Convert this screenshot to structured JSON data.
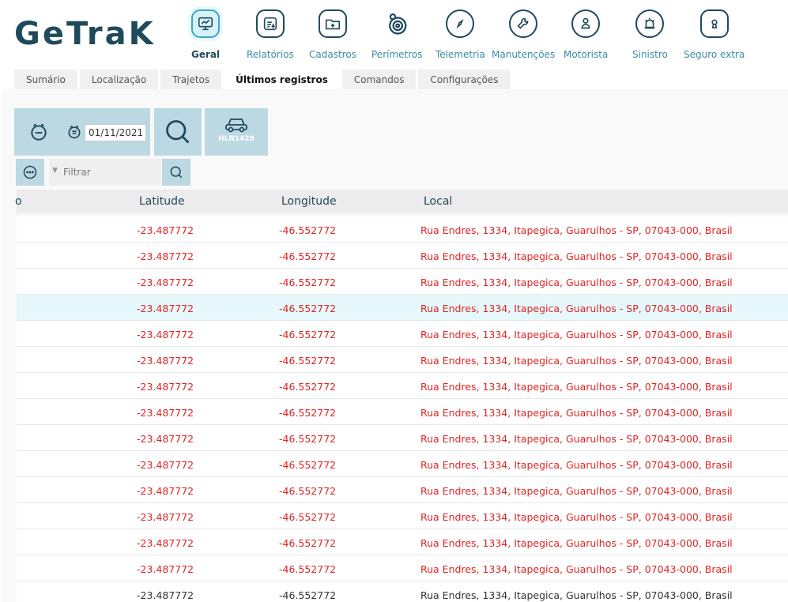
{
  "brand": {
    "logo_text": "GeTraK"
  },
  "nav": [
    {
      "label": "Geral",
      "icon": "monitor-icon",
      "active": true
    },
    {
      "label": "Relatórios",
      "icon": "report-icon",
      "active": false
    },
    {
      "label": "Cadastros",
      "icon": "folder-plus-icon",
      "active": false
    },
    {
      "label": "Perímetros",
      "icon": "perimeter-icon",
      "active": false
    },
    {
      "label": "Telemetria",
      "icon": "compass-icon",
      "active": false
    },
    {
      "label": "Manutenções",
      "icon": "wrench-icon",
      "active": false
    },
    {
      "label": "Motorista",
      "icon": "driver-icon",
      "active": false
    },
    {
      "label": "Sinistro",
      "icon": "siren-icon",
      "active": false
    },
    {
      "label": "Seguro extra",
      "icon": "keyhole-icon",
      "active": false
    }
  ],
  "subtabs": [
    {
      "label": "Sumário",
      "active": false
    },
    {
      "label": "Localização",
      "active": false
    },
    {
      "label": "Trajetos",
      "active": false
    },
    {
      "label": "Últimos registros",
      "active": true
    },
    {
      "label": "Comandos",
      "active": false
    },
    {
      "label": "Configurações",
      "active": false
    }
  ],
  "toolbar": {
    "date_value": "01/11/2021",
    "vehicle_plate": "HLN1428",
    "filter_placeholder": "Filtrar"
  },
  "table": {
    "columns": {
      "clipped": "o",
      "latitude": "Latitude",
      "longitude": "Longitude",
      "local": "Local"
    },
    "rows": [
      {
        "lat": "-23.487772",
        "lng": "-46.552772",
        "local": "Rua Endres, 1334, Itapegica, Guarulhos - SP, 07043-000, Brasil",
        "state": "alert"
      },
      {
        "lat": "-23.487772",
        "lng": "-46.552772",
        "local": "Rua Endres, 1334, Itapegica, Guarulhos - SP, 07043-000, Brasil",
        "state": "alert"
      },
      {
        "lat": "-23.487772",
        "lng": "-46.552772",
        "local": "Rua Endres, 1334, Itapegica, Guarulhos - SP, 07043-000, Brasil",
        "state": "alert"
      },
      {
        "lat": "-23.487772",
        "lng": "-46.552772",
        "local": "Rua Endres, 1334, Itapegica, Guarulhos - SP, 07043-000, Brasil",
        "state": "alert-selected"
      },
      {
        "lat": "-23.487772",
        "lng": "-46.552772",
        "local": "Rua Endres, 1334, Itapegica, Guarulhos - SP, 07043-000, Brasil",
        "state": "alert"
      },
      {
        "lat": "-23.487772",
        "lng": "-46.552772",
        "local": "Rua Endres, 1334, Itapegica, Guarulhos - SP, 07043-000, Brasil",
        "state": "alert"
      },
      {
        "lat": "-23.487772",
        "lng": "-46.552772",
        "local": "Rua Endres, 1334, Itapegica, Guarulhos - SP, 07043-000, Brasil",
        "state": "alert"
      },
      {
        "lat": "-23.487772",
        "lng": "-46.552772",
        "local": "Rua Endres, 1334, Itapegica, Guarulhos - SP, 07043-000, Brasil",
        "state": "alert"
      },
      {
        "lat": "-23.487772",
        "lng": "-46.552772",
        "local": "Rua Endres, 1334, Itapegica, Guarulhos - SP, 07043-000, Brasil",
        "state": "alert"
      },
      {
        "lat": "-23.487772",
        "lng": "-46.552772",
        "local": "Rua Endres, 1334, Itapegica, Guarulhos - SP, 07043-000, Brasil",
        "state": "alert"
      },
      {
        "lat": "-23.487772",
        "lng": "-46.552772",
        "local": "Rua Endres, 1334, Itapegica, Guarulhos - SP, 07043-000, Brasil",
        "state": "alert"
      },
      {
        "lat": "-23.487772",
        "lng": "-46.552772",
        "local": "Rua Endres, 1334, Itapegica, Guarulhos - SP, 07043-000, Brasil",
        "state": "alert"
      },
      {
        "lat": "-23.487772",
        "lng": "-46.552772",
        "local": "Rua Endres, 1334, Itapegica, Guarulhos - SP, 07043-000, Brasil",
        "state": "alert"
      },
      {
        "lat": "-23.487772",
        "lng": "-46.552772",
        "local": "Rua Endres, 1334, Itapegica, Guarulhos - SP, 07043-000, Brasil",
        "state": "alert"
      },
      {
        "lat": "-23.487772",
        "lng": "-46.552772",
        "local": "Rua Endres, 1334, Itapegica, Guarulhos - SP, 07043-000, Brasil",
        "state": "normal"
      }
    ]
  },
  "colors": {
    "brand_dark": "#1f4a5c",
    "accent": "#3a8ca6",
    "alert_text": "#e02525",
    "toolbar_bg": "#bcd8e2"
  }
}
